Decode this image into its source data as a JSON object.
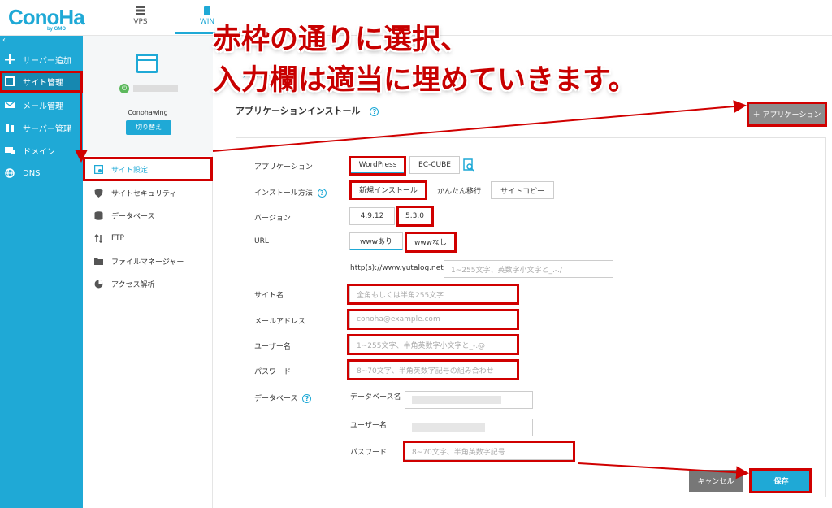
{
  "brand": {
    "logo": "ConoHa",
    "logo_sub": "by GMO"
  },
  "top_tabs": [
    {
      "label": "VPS"
    },
    {
      "label": "WIN"
    }
  ],
  "sidebar": {
    "collapse": "‹",
    "items": [
      {
        "label": "サーバー追加"
      },
      {
        "label": "サイト管理"
      },
      {
        "label": "メール管理"
      },
      {
        "label": "サーバー管理"
      },
      {
        "label": "ドメイン"
      },
      {
        "label": "DNS"
      }
    ]
  },
  "server_card": {
    "plan": "Conohawing",
    "switch_label": "切り替え"
  },
  "subnav": {
    "items": [
      {
        "label": "サイト設定"
      },
      {
        "label": "サイトセキュリティ"
      },
      {
        "label": "データベース"
      },
      {
        "label": "FTP"
      },
      {
        "label": "ファイルマネージャー"
      },
      {
        "label": "アクセス解析"
      }
    ]
  },
  "annotation": {
    "line1": "赤枠の通りに選択、",
    "line2": "入力欄は適当に埋めていきます。"
  },
  "ghost_tab": "アプリケーション",
  "page_title": "アプリケーションインストール",
  "help_glyph": "?",
  "add_app_label": "＋ アプリケーション",
  "form": {
    "application": {
      "label": "アプリケーション",
      "options": [
        "WordPress",
        "EC-CUBE"
      ],
      "selected": "WordPress"
    },
    "install_method": {
      "label": "インストール方法",
      "options": [
        "新規インストール",
        "かんたん移行",
        "サイトコピー"
      ],
      "selected": "新規インストール"
    },
    "version": {
      "label": "バージョン",
      "options": [
        "4.9.12",
        "5.3.0"
      ],
      "selected": "5.3.0"
    },
    "url": {
      "label": "URL",
      "options": [
        "wwwあり",
        "wwwなし"
      ],
      "selected": "wwwなし",
      "prefix": "http(s)://www.yutalog.net/",
      "placeholder": "1~255文字、英数字小文字と_.-./"
    },
    "site_name": {
      "label": "サイト名",
      "placeholder": "全角もしくは半角255文字"
    },
    "email": {
      "label": "メールアドレス",
      "placeholder": "conoha@example.com"
    },
    "username": {
      "label": "ユーザー名",
      "placeholder": "1~255文字、半角英数字小文字と_-.@"
    },
    "password": {
      "label": "パスワード",
      "placeholder": "8~70文字、半角英数字記号の組み合わせ"
    },
    "database": {
      "label": "データベース",
      "db_name_label": "データベース名",
      "db_user_label": "ユーザー名",
      "db_password_label": "パスワード",
      "db_password_placeholder": "8~70文字、半角英数字記号"
    }
  },
  "buttons": {
    "cancel": "キャンセル",
    "save": "保存"
  },
  "colors": {
    "brand": "#1fa9d6",
    "annotation_red": "#c80000"
  }
}
